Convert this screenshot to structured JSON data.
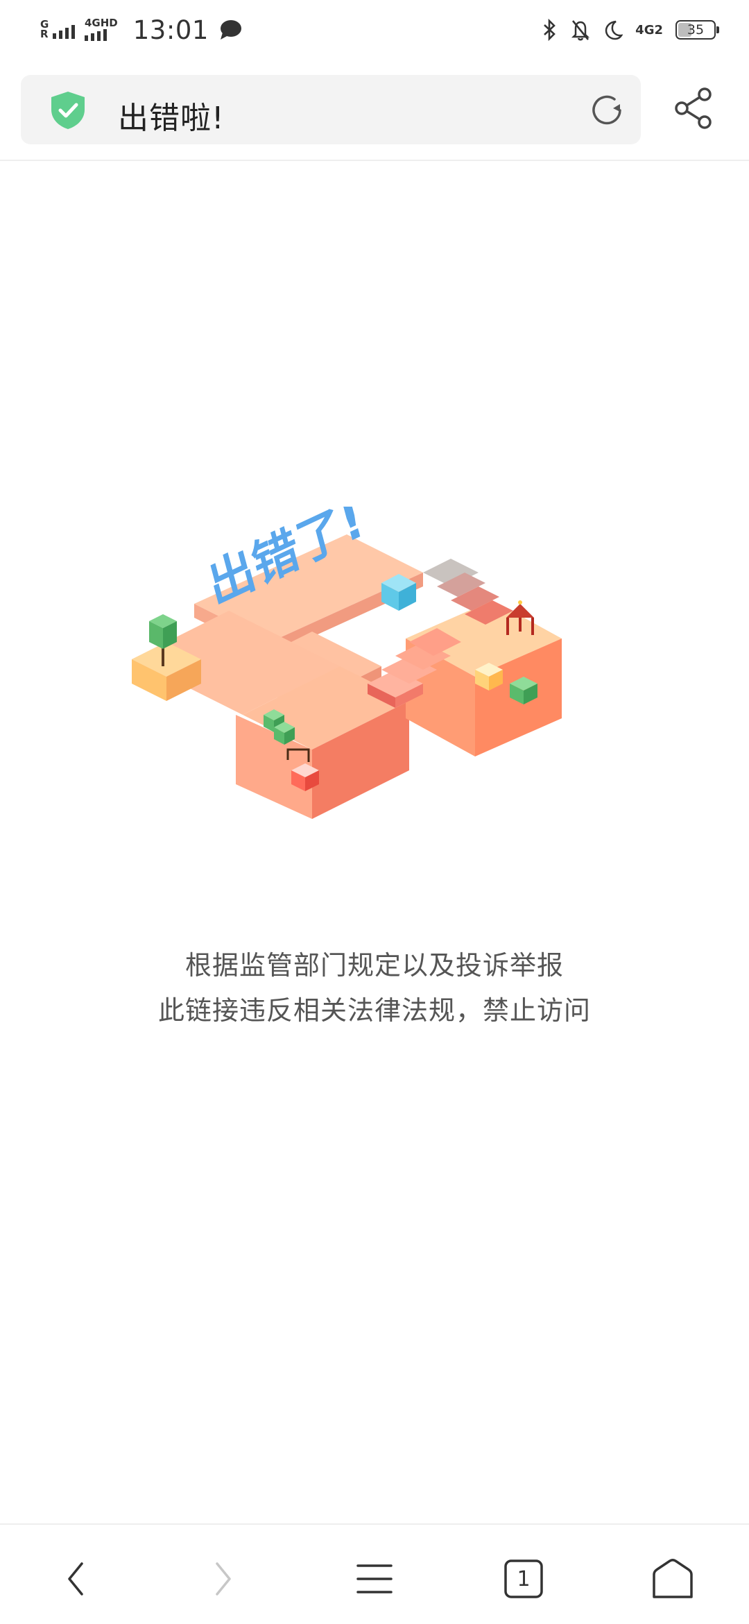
{
  "status_bar": {
    "time": "13:01",
    "signal1_label": "G R",
    "signal2_label": "4GHD",
    "network_label": "4G2",
    "battery_level": "35"
  },
  "address_bar": {
    "title": "出错啦!"
  },
  "content": {
    "message_line1": "根据监管部门规定以及投诉举报",
    "message_line2": "此链接违反相关法律法规，禁止访问",
    "illustration_text": "出错了!"
  },
  "bottom_nav": {
    "tab_count": "1"
  },
  "colors": {
    "shield": "#5fce8d",
    "accent_text": "#5aa7ec"
  }
}
